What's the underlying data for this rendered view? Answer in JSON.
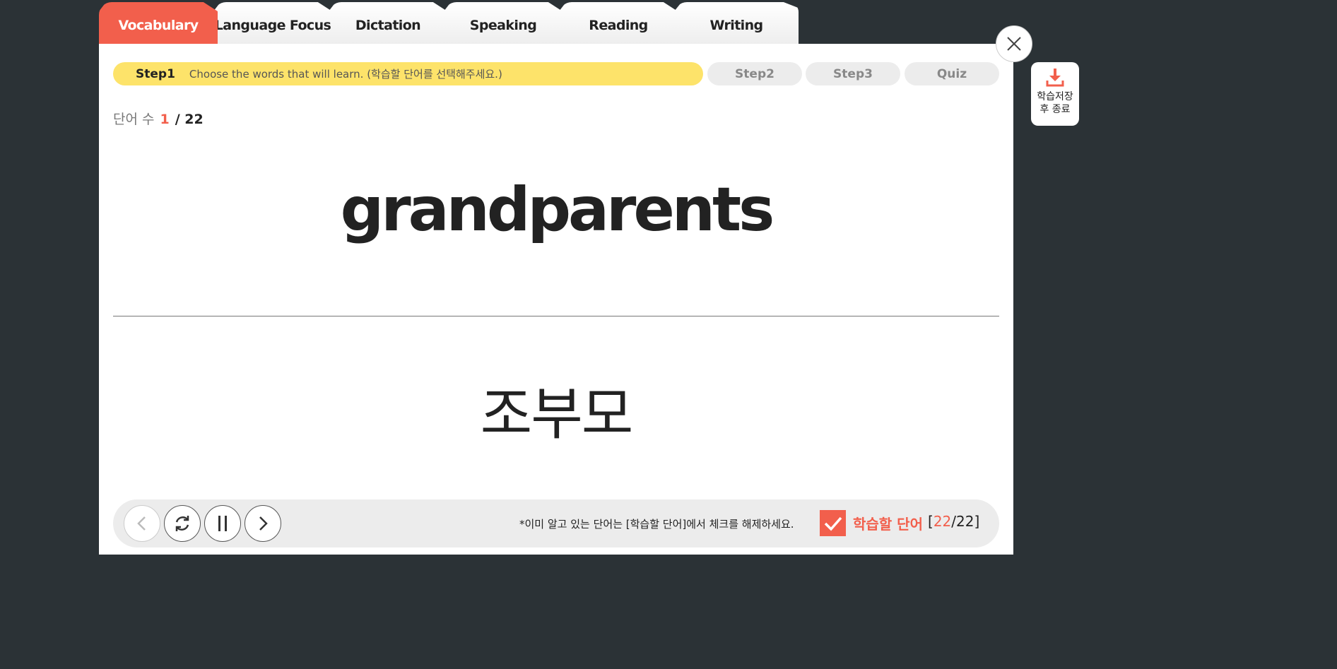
{
  "tabs": [
    {
      "label": "Vocabulary",
      "active": true
    },
    {
      "label": "Language Focus",
      "active": false
    },
    {
      "label": "Dictation",
      "active": false
    },
    {
      "label": "Speaking",
      "active": false
    },
    {
      "label": "Reading",
      "active": false
    },
    {
      "label": "Writing",
      "active": false
    }
  ],
  "steps": {
    "step1_label": "Step1",
    "step1_desc": "Choose the words that will learn. (학습할 단어를 선택해주세요.)",
    "step2_label": "Step2",
    "step3_label": "Step3",
    "quiz_label": "Quiz"
  },
  "counter": {
    "label": "단어 수",
    "current": "1",
    "total": "/ 22"
  },
  "card": {
    "word": "grandparents",
    "meaning": "조부모"
  },
  "controls": {
    "hint": "*이미 알고 있는 단어는 [학습할 단어]에서 체크를 해제하세요.",
    "checkbox_checked": true,
    "learn_label": "학습할 단어",
    "learn_open": "[",
    "learn_selected": "22",
    "learn_total": "/22]"
  },
  "save": {
    "line1": "학습저장",
    "line2": "후 종료"
  },
  "icons": {
    "prev": "chevron-left-icon",
    "replay": "refresh-icon",
    "pause": "pause-icon",
    "next": "chevron-right-icon",
    "close": "close-icon",
    "save": "download-icon",
    "check": "check-icon"
  },
  "colors": {
    "accent": "#f25f4c",
    "step_active": "#fde36a",
    "background": "#2b3236"
  }
}
